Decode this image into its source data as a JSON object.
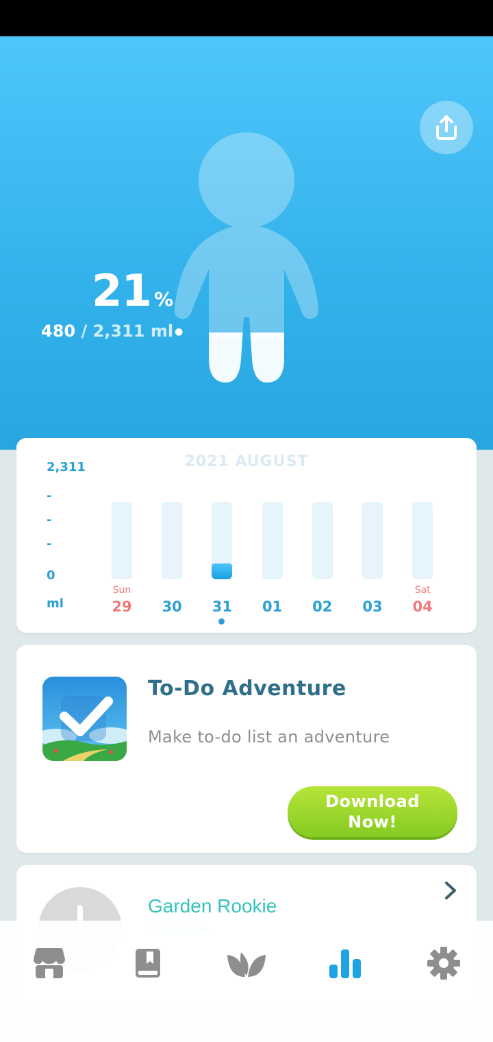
{
  "hero": {
    "percent": "21",
    "percent_sign": "%",
    "amount_current": "480",
    "amount_total": " / 2,311 ml",
    "progress_fraction": 0.21
  },
  "chart_data": {
    "type": "bar",
    "title": "2021 AUGUST",
    "ylabel": "ml",
    "y_ticks": [
      "2,311",
      "-",
      "-",
      "-",
      "0"
    ],
    "ylim": [
      0,
      2311
    ],
    "categories": [
      "29",
      "30",
      "31",
      "01",
      "02",
      "03",
      "04"
    ],
    "day_of_week": [
      "Sun",
      "",
      "",
      "",
      "",
      "",
      "Sat"
    ],
    "values": [
      0,
      0,
      480,
      0,
      0,
      0,
      0
    ],
    "selected_index": 2
  },
  "promo": {
    "title": "To-Do Adventure",
    "subtitle": "Make to-do list an adventure",
    "button_label": "Download Now!"
  },
  "achievement": {
    "title": "Garden Rookie",
    "progress": 0.3
  },
  "nav": {
    "items": [
      "shop-icon",
      "journal-icon",
      "plant-icon",
      "stats-icon",
      "settings-icon"
    ],
    "active_index": 3,
    "active_color": "#1ea3e4",
    "inactive_color": "#8e8e8e"
  }
}
